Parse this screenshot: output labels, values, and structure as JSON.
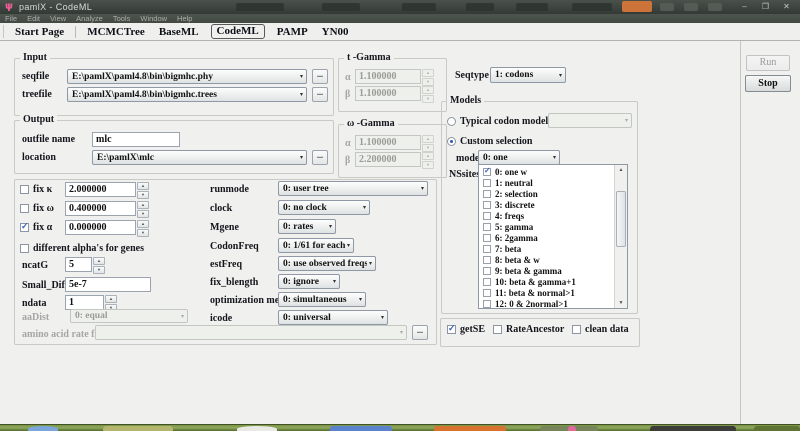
{
  "window": {
    "title": "pamlX  -  CodeML"
  },
  "icons": {
    "minimize": "–",
    "maximize": "❐",
    "close": "✕",
    "dropdown": "▾",
    "spin_up": "▲",
    "spin_down": "▼",
    "scroll_up": "▲",
    "scroll_down": "▼",
    "browse": "..."
  },
  "menu": {
    "items": [
      "File",
      "Edit",
      "View",
      "Analyze",
      "Tools",
      "Window",
      "Help"
    ]
  },
  "tabs": {
    "items": [
      "Start Page",
      "MCMCTree",
      "BaseML",
      "CodeML",
      "PAMP",
      "YN00"
    ],
    "selected": "CodeML"
  },
  "input": {
    "title": "Input",
    "seqfile": {
      "label": "seqfile",
      "value": "E:\\pamlX\\paml4.8\\bin\\bigmhc.phy"
    },
    "treefile": {
      "label": "treefile",
      "value": "E:\\pamlX\\paml4.8\\bin\\bigmhc.trees"
    }
  },
  "output": {
    "title": "Output",
    "outfile": {
      "label": "outfile name",
      "value": "mlc"
    },
    "location": {
      "label": "location",
      "value": "E:\\pamlX\\mlc"
    }
  },
  "t_gamma": {
    "title": "t -Gamma",
    "alpha": {
      "label": "α",
      "value": "1.100000"
    },
    "beta": {
      "label": "β",
      "value": "1.100000"
    }
  },
  "w_gamma": {
    "title": "ω -Gamma",
    "alpha": {
      "label": "α",
      "value": "1.100000"
    },
    "beta": {
      "label": "β",
      "value": "2.200000"
    }
  },
  "params": {
    "fix_kappa": {
      "label": "fix κ",
      "value": "2.000000",
      "checked": false
    },
    "fix_omega": {
      "label": "fix ω",
      "value": "0.400000",
      "checked": false
    },
    "fix_alpha": {
      "label": "fix α",
      "value": "0.000000",
      "checked": true
    },
    "diff_alpha": {
      "label": "different alpha's for genes",
      "checked": false
    },
    "ncatG": {
      "label": "ncatG",
      "value": "5"
    },
    "small_diff": {
      "label": "Small_Diff",
      "value": "5e-7"
    },
    "ndata": {
      "label": "ndata",
      "value": "1"
    },
    "aadist": {
      "label": "aaDist",
      "value": "0: equal",
      "disabled": true
    },
    "aa_rate_file": {
      "label": "amino acid rate file",
      "value": "",
      "disabled": true
    }
  },
  "options": {
    "runmode": {
      "label": "runmode",
      "value": "0: user tree"
    },
    "clock": {
      "label": "clock",
      "value": "0: no clock"
    },
    "mgene": {
      "label": "Mgene",
      "value": "0: rates"
    },
    "codonfreq": {
      "label": "CodonFreq",
      "value": "0: 1/61 for each"
    },
    "estfreq": {
      "label": "estFreq",
      "value": "0: use observed freqs"
    },
    "fix_blength": {
      "label": "fix_blength",
      "value": "0: ignore"
    },
    "opt_method": {
      "label": "optimization method",
      "value": "0: simultaneous"
    },
    "icode": {
      "label": "icode",
      "value": "0: universal"
    }
  },
  "seqtype": {
    "label": "Seqtype",
    "value": "1: codons"
  },
  "models": {
    "title": "Models",
    "typical": {
      "label": "Typical codon model",
      "selected": false,
      "value": ""
    },
    "custom": {
      "label": "Custom selection",
      "selected": true
    },
    "model": {
      "label": "model",
      "value": "0: one"
    },
    "nssites": {
      "label": "NSsites",
      "items": [
        {
          "label": "0: one w",
          "checked": true
        },
        {
          "label": "1: neutral",
          "checked": false
        },
        {
          "label": "2: selection",
          "checked": false
        },
        {
          "label": "3: discrete",
          "checked": false
        },
        {
          "label": "4: freqs",
          "checked": false
        },
        {
          "label": "5: gamma",
          "checked": false
        },
        {
          "label": "6: 2gamma",
          "checked": false
        },
        {
          "label": "7: beta",
          "checked": false
        },
        {
          "label": "8: beta & w",
          "checked": false
        },
        {
          "label": "9: beta & gamma",
          "checked": false
        },
        {
          "label": "10: beta & gamma+1",
          "checked": false
        },
        {
          "label": "11: beta & normal>1",
          "checked": false
        },
        {
          "label": "12: 0 & 2normal>1",
          "checked": false
        }
      ]
    }
  },
  "flags": {
    "getse": {
      "label": "getSE",
      "checked": true
    },
    "rateancestor": {
      "label": "RateAncestor",
      "checked": false
    },
    "cleandata": {
      "label": "clean data",
      "checked": false
    }
  },
  "actions": {
    "run": "Run",
    "stop": "Stop"
  },
  "colors": {
    "titlebar": "#3a413b",
    "taskbar": "#6d8440",
    "accent_check": "#3863c4",
    "highlight_orange": "#d4763a"
  }
}
